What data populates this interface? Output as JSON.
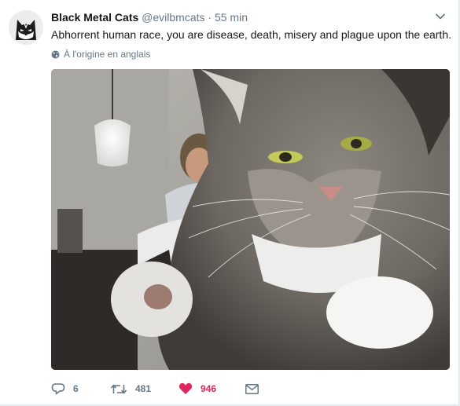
{
  "tweet": {
    "author_name": "Black Metal Cats",
    "author_handle": "@evilbmcats",
    "separator": "·",
    "time_ago": "55 min",
    "text": "Abhorrent human race, you are disease, death, misery and plague upon the earth.",
    "translate_label": "À l'origine en anglais",
    "media_description": "Long-haired grey tabby cat glaring at the camera with a white paw raised; a person reclining on a bed in the background",
    "actions": {
      "reply_count": "6",
      "retweet_count": "481",
      "like_count": "946"
    }
  },
  "colors": {
    "like_active": "#e0245e",
    "secondary_text": "#657786",
    "primary_text": "#14171a"
  },
  "icons": [
    "caret-down-icon",
    "globe-icon",
    "reply-icon",
    "retweet-icon",
    "heart-icon",
    "envelope-icon"
  ]
}
